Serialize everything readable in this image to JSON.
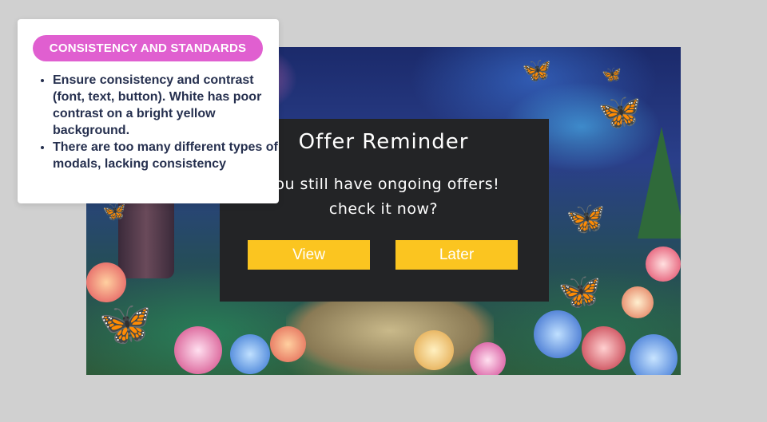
{
  "annotation": {
    "heading": "CONSISTENCY AND STANDARDS",
    "notes": [
      "Ensure consistency and contrast (font, text, button). White has poor contrast on a bright yellow background.",
      "There are too many different types of modals, lacking consistency"
    ],
    "heading_color": "#e05fd0"
  },
  "modal": {
    "title": "Offer Reminder",
    "message": "You still have ongoing offers! check it now?",
    "buttons": {
      "view": "View",
      "later": "Later"
    },
    "button_color": "#fbc520",
    "background_color": "#232426"
  }
}
